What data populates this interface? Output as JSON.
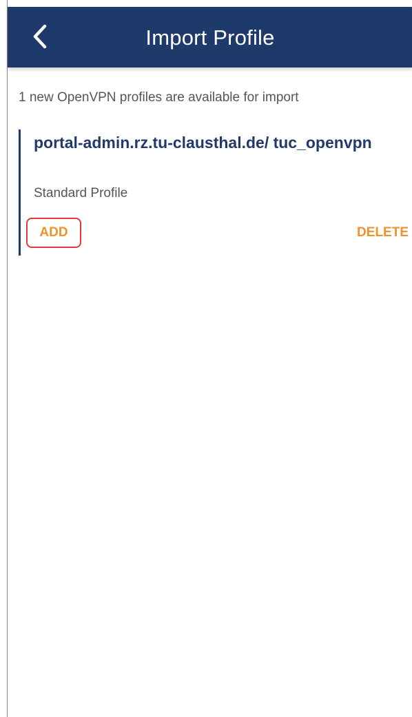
{
  "header": {
    "title": "Import Profile",
    "back_icon": "chevron-left-icon",
    "background_color": "#1e3a6b"
  },
  "info": {
    "text": "1 new OpenVPN profiles are available for import"
  },
  "profile_card": {
    "title": "portal-admin.rz.tu-clausthal.de/ tuc_openvpn",
    "subtitle": "Standard Profile",
    "add_label": "ADD",
    "delete_label": "DELETE",
    "accent_color": "#f0922b",
    "highlight_color": "#e0393e"
  }
}
